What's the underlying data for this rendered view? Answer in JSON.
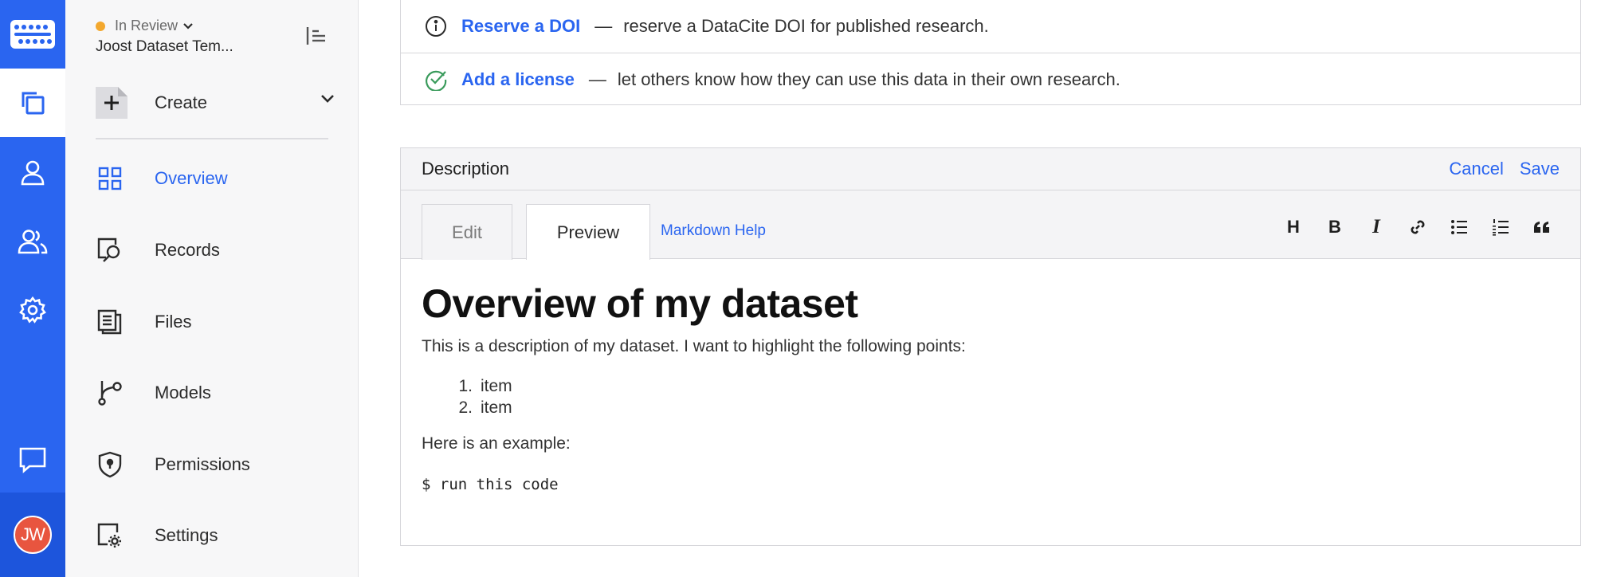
{
  "nav": {
    "status": "In Review",
    "dataset_name": "Joost Dataset Tem...",
    "create_label": "Create",
    "items": [
      {
        "label": "Overview",
        "icon": "grid-icon"
      },
      {
        "label": "Records",
        "icon": "records-search-icon"
      },
      {
        "label": "Files",
        "icon": "files-icon"
      },
      {
        "label": "Models",
        "icon": "models-branch-icon"
      },
      {
        "label": "Permissions",
        "icon": "shield-icon"
      },
      {
        "label": "Settings",
        "icon": "settings-gear-icon"
      }
    ]
  },
  "rail": {
    "user_initials": "JW"
  },
  "tips": [
    {
      "link": "Reserve a DOI",
      "dash": "—",
      "text": "reserve a DataCite DOI for published research."
    },
    {
      "link": "Add a license",
      "dash": "—",
      "text": "let others know how they can use this data in their own research."
    }
  ],
  "description": {
    "title": "Description",
    "cancel": "Cancel",
    "save": "Save",
    "tab_edit": "Edit",
    "tab_preview": "Preview",
    "markdown_help": "Markdown Help",
    "format_buttons": [
      "H",
      "B",
      "I"
    ],
    "preview": {
      "heading": "Overview of my dataset",
      "paragraph": "This is a description of my dataset. I want to highlight the following points:",
      "list": [
        {
          "num": "1.",
          "text": "item"
        },
        {
          "num": "2.",
          "text": "item"
        }
      ],
      "paragraph2": "Here is an example:",
      "code": "$ run this code"
    }
  },
  "colors": {
    "brand": "#2a65f0",
    "status_in_review": "#f3a82e",
    "avatar": "#e8553f",
    "license_check": "#3a9b5c"
  }
}
